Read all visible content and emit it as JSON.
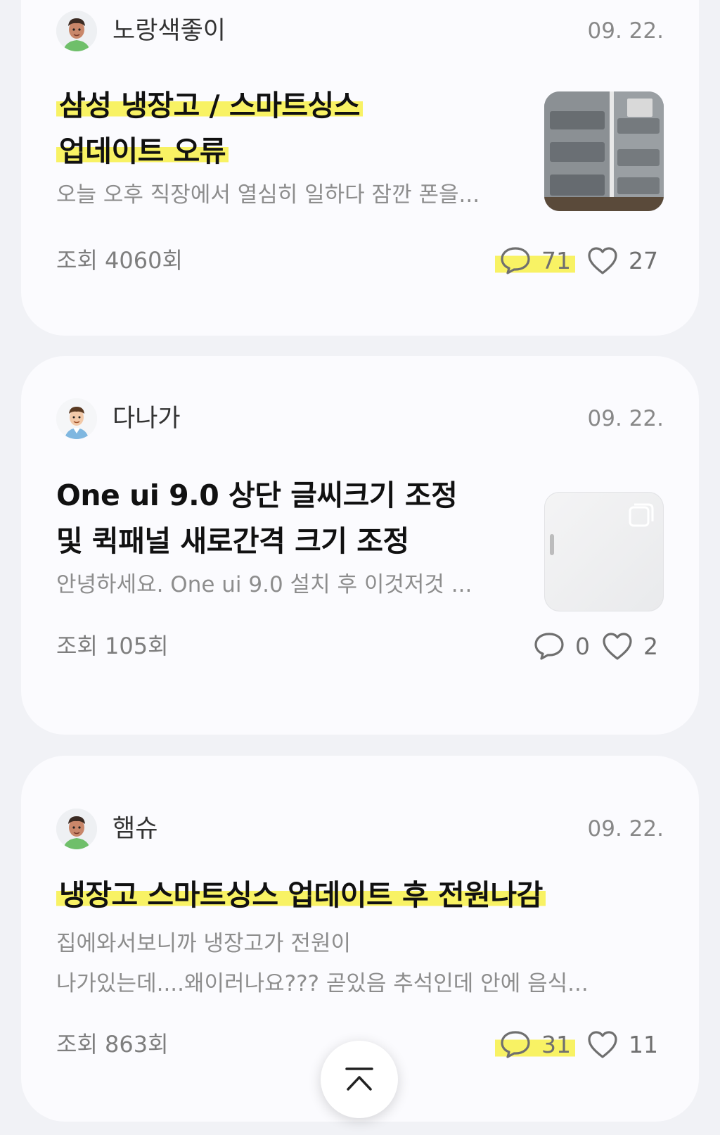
{
  "posts": [
    {
      "author": "노랑색좋이",
      "date": "09. 22.",
      "title_lines": [
        "삼성 냉장고 / 스마트싱스",
        "업데이트 오류"
      ],
      "excerpt": "오늘 오후 직장에서 열심히 일하다 잠깐 폰을...",
      "views": "조회 4060회",
      "comments": "71",
      "likes": "27",
      "avatar_icon": "man-avatar-icon",
      "thumbnail": "refrigerator-photo"
    },
    {
      "author": "다나가",
      "date": "09. 22.",
      "title_lines": [
        "One ui 9.0 상단 글씨크기 조정",
        "및 퀵패널 새로간격 크기 조정"
      ],
      "excerpt": "안녕하세요. One ui 9.0 설치 후 이것저것 ...",
      "views": "조회 105회",
      "comments": "0",
      "likes": "2",
      "avatar_icon": "man-avatar-icon",
      "thumbnail": "blurred-screenshot"
    },
    {
      "author": "햄슈",
      "date": "09. 22.",
      "title_lines": [
        "냉장고 스마트싱스 업데이트 후 전원나감"
      ],
      "excerpt_lines": [
        "집에와서보니까 냉장고가 전원이",
        "나가있는데....왜이러나요??? 곧있음 추석인데 안에 음식..."
      ],
      "views": "조회 863회",
      "comments": "31",
      "likes": "11",
      "avatar_icon": "man-avatar-icon"
    }
  ],
  "highlight_color": "#f8f264",
  "scroll_top_icon": "chevron-up-bar-icon"
}
